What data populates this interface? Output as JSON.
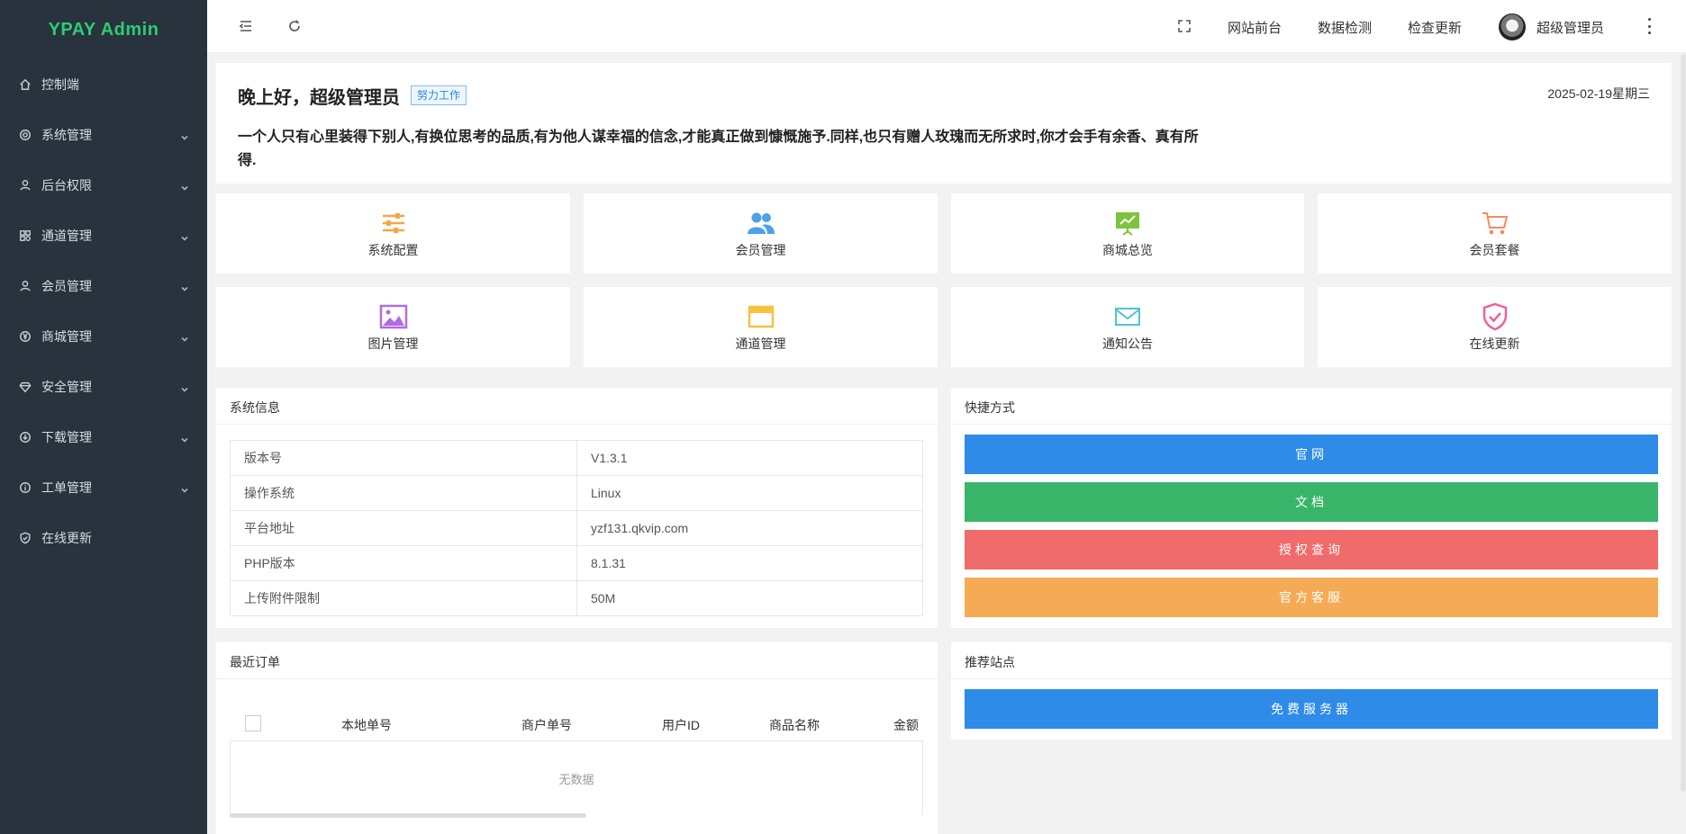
{
  "sidebar": {
    "logo": "YPAY Admin",
    "items": [
      {
        "label": "控制端",
        "icon": "home-icon"
      },
      {
        "label": "系统管理",
        "icon": "gear-icon"
      },
      {
        "label": "后台权限",
        "icon": "user-icon"
      },
      {
        "label": "通道管理",
        "icon": "apps-icon"
      },
      {
        "label": "会员管理",
        "icon": "user-icon"
      },
      {
        "label": "商城管理",
        "icon": "yen-icon"
      },
      {
        "label": "安全管理",
        "icon": "diamond-icon"
      },
      {
        "label": "下载管理",
        "icon": "download-icon"
      },
      {
        "label": "工单管理",
        "icon": "info-icon"
      },
      {
        "label": "在线更新",
        "icon": "shield-check-icon"
      }
    ]
  },
  "header": {
    "links": [
      "网站前台",
      "数据检测",
      "检查更新"
    ],
    "user_name": "超级管理员"
  },
  "welcome": {
    "greeting": "晚上好，超级管理员",
    "badge": "努力工作",
    "date": "2025-02-19星期三",
    "quote": "一个人只有心里装得下别人,有换位思考的品质,有为他人谋幸福的信念,才能真正做到慷慨施予.同样,也只有赠人玫瑰而无所求时,你才会手有余香、真有所得."
  },
  "tiles": [
    {
      "label": "系统配置",
      "icon": "sliders-icon",
      "color": "#f5a742"
    },
    {
      "label": "会员管理",
      "icon": "users-icon",
      "color": "#4aa3e8"
    },
    {
      "label": "商城总览",
      "icon": "presentation-icon",
      "color": "#7cc43b"
    },
    {
      "label": "会员套餐",
      "icon": "cart-icon",
      "color": "#f58a5c"
    },
    {
      "label": "图片管理",
      "icon": "image-icon",
      "color": "#b36be0"
    },
    {
      "label": "通道管理",
      "icon": "window-icon",
      "color": "#f5c242"
    },
    {
      "label": "通知公告",
      "icon": "mail-icon",
      "color": "#4cc6c9"
    },
    {
      "label": "在线更新",
      "icon": "shield-check-icon",
      "color": "#f0609c"
    }
  ],
  "system_info": {
    "title": "系统信息",
    "rows": [
      {
        "key": "版本号",
        "value": "V1.3.1"
      },
      {
        "key": "操作系统",
        "value": "Linux"
      },
      {
        "key": "平台地址",
        "value": "yzf131.qkvip.com"
      },
      {
        "key": "PHP版本",
        "value": "8.1.31"
      },
      {
        "key": "上传附件限制",
        "value": "50M"
      }
    ]
  },
  "shortcuts": {
    "title": "快捷方式",
    "buttons": [
      {
        "label": "官网",
        "color": "#2e8be8"
      },
      {
        "label": "文档",
        "color": "#38b569"
      },
      {
        "label": "授权查询",
        "color": "#f06b6b"
      },
      {
        "label": "官方客服",
        "color": "#f5ab55"
      }
    ]
  },
  "orders": {
    "title": "最近订单",
    "columns": [
      "本地单号",
      "商户单号",
      "用户ID",
      "商品名称",
      "金额"
    ],
    "empty_text": "无数据"
  },
  "recommend": {
    "title": "推荐站点",
    "buttons": [
      {
        "label": "免费服务器",
        "color": "#2e8be8"
      }
    ]
  }
}
